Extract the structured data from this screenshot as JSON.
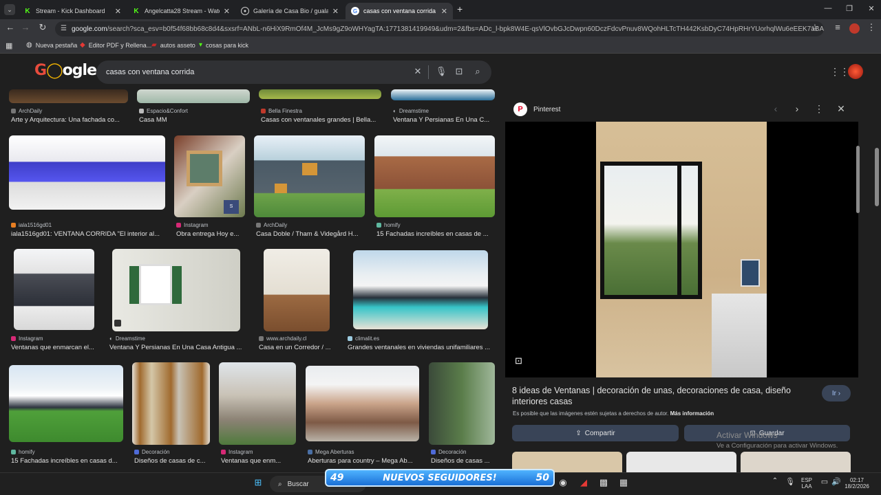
{
  "browser": {
    "tabs": [
      {
        "title": "Stream - Kick Dashboard",
        "favicon": "kick-icon",
        "active": false
      },
      {
        "title": "Angelcatta28 Stream - Watch Li",
        "favicon": "kick-icon",
        "active": false
      },
      {
        "title": "Galería de Casa Bio / gualano",
        "favicon": "archdaily-icon",
        "active": false
      },
      {
        "title": "casas con ventana corrida - Bus",
        "favicon": "google-icon",
        "active": true
      }
    ],
    "url_host": "google.com",
    "url_rest": "/search?sca_esv=b0f54f68bb68c8d4&sxsrf=ANbL-n6HiX9RmOf4M_JcMs9gZ9oWHYagTA:1771381419949&udm=2&fbs=ADc_l-bpk8W4E-qsVlOvbGJcDwpn60DczFdcvPnuv8WQohHLTcTH442KsbDyC74HpRHrYUorhqlWu6eEEK7aBAtTZpD8FGlRodo...",
    "bookmarks": [
      {
        "label": "Nueva pestaña",
        "icon": "globe-icon"
      },
      {
        "label": "Editor PDF y Rellena...",
        "icon": "pdf-icon"
      },
      {
        "label": "autos asseto",
        "icon": "folder-icon"
      },
      {
        "label": "cosas para kick",
        "icon": "kick-icon"
      }
    ]
  },
  "google": {
    "logo": "Google",
    "query": "casas con ventana corrida"
  },
  "results": [
    {
      "source": "ArchDaily",
      "caption": "Arte y Arquitectura: Una fachada co..."
    },
    {
      "source": "Espacio&Confort",
      "caption": "Casa MM"
    },
    {
      "source": "Bella Finestra",
      "caption": "Casas con ventanales grandes | Bella..."
    },
    {
      "source": "Dreamstime",
      "caption": "Ventana Y Persianas En Una C..."
    },
    {
      "source": "iala1516gd01",
      "caption": "iala1516gd01: VENTANA CORRIDA \"El interior al..."
    },
    {
      "source": "Instagram",
      "caption": "Obra entrega Hoy e..."
    },
    {
      "source": "ArchDaily",
      "caption": "Casa Doble / Tham & Videgård H..."
    },
    {
      "source": "homify",
      "caption": "15 Fachadas increíbles en casas de ..."
    },
    {
      "source": "Instagram",
      "caption": "Ventanas que enmarcan el..."
    },
    {
      "source": "Dreamstime",
      "caption": "Ventana Y Persianas En Una Casa Antigua ..."
    },
    {
      "source": "www.archdaily.cl",
      "caption": "Casa en un Corredor / ..."
    },
    {
      "source": "climalit.es",
      "caption": "Grandes ventanales en viviendas unifamiliares ..."
    },
    {
      "source": "homify",
      "caption": "15 Fachadas increíbles en casas d..."
    },
    {
      "source": "Decoración",
      "caption": "Diseños de casas de c..."
    },
    {
      "source": "Instagram",
      "caption": "Ventanas que enm..."
    },
    {
      "source": "Mega Aberturas",
      "caption": "Aberturas para country – Mega Ab..."
    },
    {
      "source": "Decoración",
      "caption": "Diseños de casas ..."
    }
  ],
  "panel": {
    "source": "Pinterest",
    "title": "8 ideas de Ventanas | decoración de unas, decoraciones de casa, diseño interiores casas",
    "visit_label": "Ir",
    "copyright": "Es posible que las imágenes estén sujetas a derechos de autor.",
    "more_info": "Más información",
    "share_label": "Compartir",
    "save_label": "Guardar"
  },
  "windows": {
    "activate_title": "Activar Windows",
    "activate_sub": "Ve a Configuración para activar Windows."
  },
  "taskbar": {
    "search_label": "Buscar",
    "banner_left": "49",
    "banner_text": "NUEVOS SEGUIDORES!",
    "banner_right": "50",
    "lang1": "ESP",
    "lang2": "LAA",
    "time": "02:17",
    "date": "18/2/2026"
  },
  "colors": {
    "accent": "#a8c7fa",
    "pinterest": "#e60023",
    "kick": "#53fc18"
  }
}
